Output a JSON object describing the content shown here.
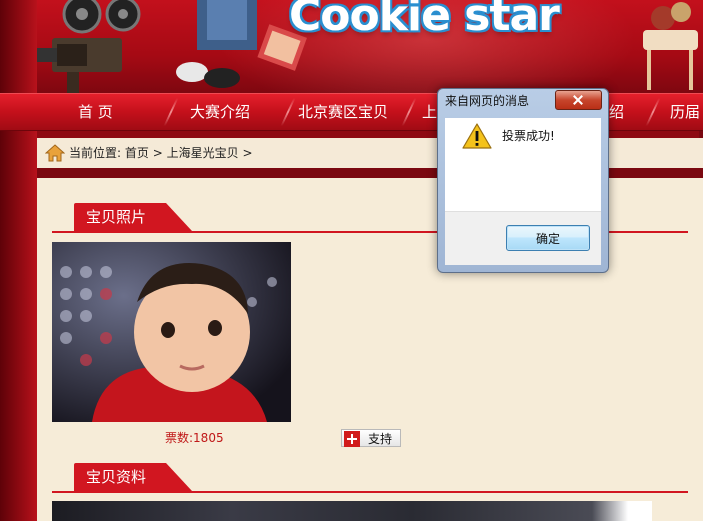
{
  "banner": {
    "logo_text": "Cookie star"
  },
  "nav": {
    "items": [
      "首 页",
      "大赛介绍",
      "北京赛区宝贝",
      "上",
      "绍",
      "历届"
    ]
  },
  "breadcrumb": {
    "prefix": "当前位置:",
    "home": "首页",
    "sep": ">",
    "current": "上海星光宝贝"
  },
  "sections": {
    "photo_title": "宝贝照片",
    "info_title": "宝贝资料"
  },
  "photo": {
    "votes_label": "票数:1805"
  },
  "support_button": {
    "label": "支持"
  },
  "dialog": {
    "title": "来自网页的消息",
    "message": "投票成功!",
    "ok_label": "确定"
  },
  "colors": {
    "nav_red": "#c4101b",
    "content_bg": "#f6ecd8",
    "accent_red": "#d11620"
  }
}
